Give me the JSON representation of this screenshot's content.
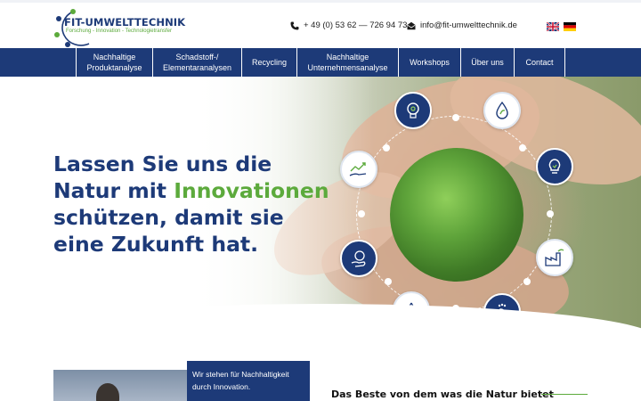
{
  "brand": {
    "name": "FIT-UMWELTTECHNIK",
    "tagline": "Forschung - Innovation - Technologietransfer",
    "colors": {
      "primary": "#1d3a78",
      "accent": "#5caa3c"
    }
  },
  "contact": {
    "phone_icon": "phone-icon",
    "phone": "+ 49 (0) 53 62 — 726 94 73",
    "email_icon": "envelope-icon",
    "email": "info@fit-umwelttechnik.de"
  },
  "languages": [
    {
      "icon": "uk-flag-icon"
    },
    {
      "icon": "german-flag-icon"
    }
  ],
  "nav": {
    "items": [
      {
        "label": "Nachhaltige\nProduktanalyse"
      },
      {
        "label": "Schadstoff-/\nElementaranalysen"
      },
      {
        "label": "Recycling"
      },
      {
        "label": "Nachhaltige\nUnternehmensanalyse"
      },
      {
        "label": "Workshops"
      },
      {
        "label": "Über uns"
      },
      {
        "label": "Contact"
      }
    ]
  },
  "hero": {
    "headline_part1": "Lassen Sie uns die Natur mit ",
    "headline_highlight": "Innovationen",
    "headline_part2": " schützen, damit sie eine Zukunft hat.",
    "icons": [
      "lightbulb-gear-icon",
      "water-drop-leaf-icon",
      "lightbulb-icon",
      "factory-icon",
      "footprint-icon",
      "recycle-icon",
      "hand-world-icon",
      "growth-chart-hand-icon"
    ]
  },
  "intro": {
    "box_text": "Wir stehen für Nachhaltigkeit durch Innovation.",
    "section_title": "Das Beste von dem was die Natur bietet"
  }
}
